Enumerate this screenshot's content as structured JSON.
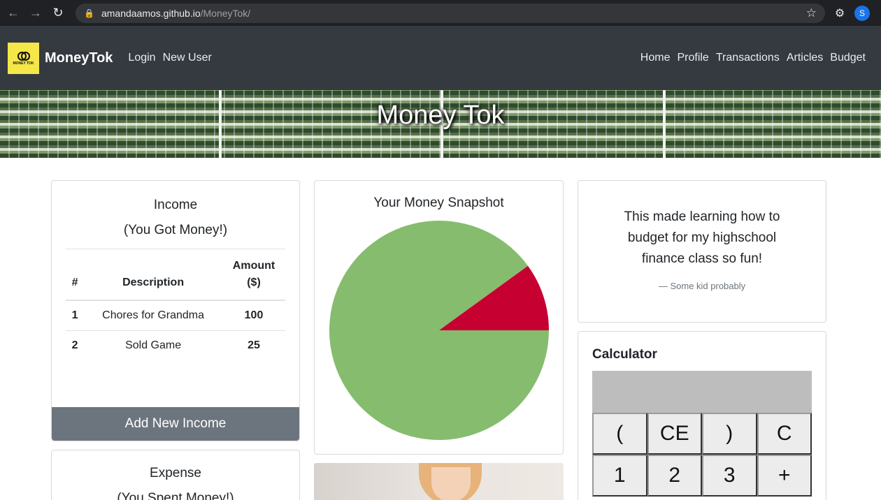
{
  "browser": {
    "url_host": "amandaamos.github.io",
    "url_path": "/MoneyTok/",
    "profile_initial": "S"
  },
  "navbar": {
    "brand": "MoneyTok",
    "logo_text": "MONEY TOK",
    "left_links": [
      "Login",
      "New User"
    ],
    "right_links": [
      "Home",
      "Profile",
      "Transactions",
      "Articles",
      "Budget"
    ]
  },
  "banner": {
    "title": "Money Tok"
  },
  "income": {
    "title": "Income",
    "subtitle": "(You Got Money!)",
    "headers": [
      "#",
      "Description",
      "Amount ($)"
    ],
    "rows": [
      {
        "num": "1",
        "description": "Chores for Grandma",
        "amount": "100"
      },
      {
        "num": "2",
        "description": "Sold Game",
        "amount": "25"
      }
    ],
    "add_button": "Add New Income"
  },
  "expense": {
    "title": "Expense",
    "subtitle": "(You Spent Money!)"
  },
  "snapshot": {
    "title": "Your Money Snapshot",
    "slices": [
      {
        "label": "",
        "value": 0.9,
        "color": "#86bc6e"
      },
      {
        "label": "",
        "value": 0.1,
        "color": "#c70032"
      }
    ]
  },
  "quote": {
    "text": "This made learning how to budget for my highschool finance class so fun!",
    "footer": "Some kid probably"
  },
  "calculator": {
    "title": "Calculator",
    "display": "",
    "keys": [
      "(",
      "CE",
      ")",
      "C",
      "1",
      "2",
      "3",
      "+"
    ]
  },
  "colors": {
    "navbar_bg": "#343a40",
    "button_bg": "#6c757d",
    "pie_income": "#86bc6e",
    "pie_expense": "#c70032"
  }
}
